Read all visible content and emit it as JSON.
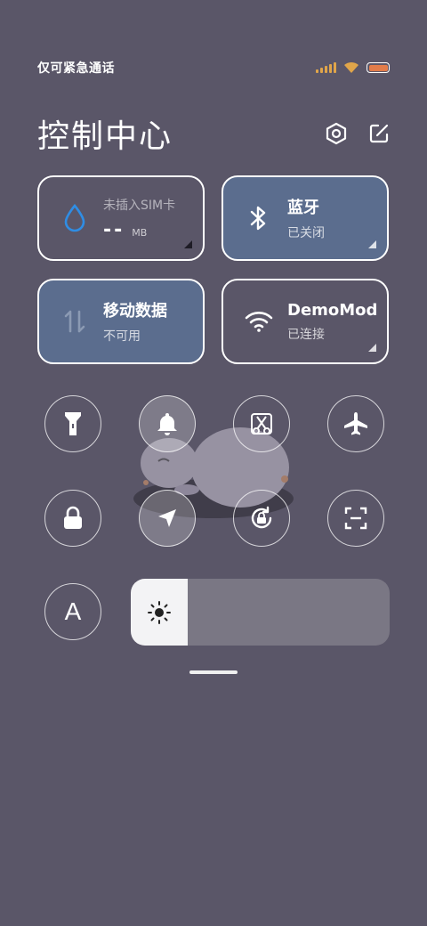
{
  "status_bar": {
    "carrier_text": "仅可紧急通话",
    "icons": [
      "signal-icon",
      "wifi-icon",
      "battery-icon"
    ],
    "battery_color": "#e27c4a"
  },
  "header": {
    "title": "控制中心",
    "actions": [
      "settings-icon",
      "edit-icon"
    ]
  },
  "cards": {
    "data_usage": {
      "label": "未插入SIM卡",
      "value": "--",
      "unit": "MB",
      "icon": "water-drop-icon"
    },
    "bluetooth": {
      "title": "蓝牙",
      "status": "已关闭",
      "icon": "bluetooth-icon",
      "active": true
    },
    "mobile_data": {
      "title": "移动数据",
      "status": "不可用",
      "icon": "data-arrows-icon",
      "active": true
    },
    "wifi": {
      "title": "DemoMod",
      "status": "已连接",
      "icon": "wifi-icon",
      "active": false
    }
  },
  "toggles": [
    {
      "name": "flashlight",
      "icon": "flashlight-icon",
      "on": false
    },
    {
      "name": "silent",
      "icon": "bell-icon",
      "on": true
    },
    {
      "name": "screenshot",
      "icon": "screenshot-icon",
      "on": false
    },
    {
      "name": "airplane",
      "icon": "airplane-icon",
      "on": false
    },
    {
      "name": "lock-screen",
      "icon": "lock-icon",
      "on": false
    },
    {
      "name": "location",
      "icon": "location-icon",
      "on": true
    },
    {
      "name": "rotation-lock",
      "icon": "rotation-lock-icon",
      "on": false
    },
    {
      "name": "scanner",
      "icon": "scan-icon",
      "on": false
    }
  ],
  "auto_brightness": {
    "label": "A"
  },
  "brightness": {
    "level": 0.22,
    "icon": "sun-icon"
  },
  "colors": {
    "background": "#5a5668",
    "active_card": "#5b6d8e",
    "accent_blue": "#2f8de4"
  }
}
